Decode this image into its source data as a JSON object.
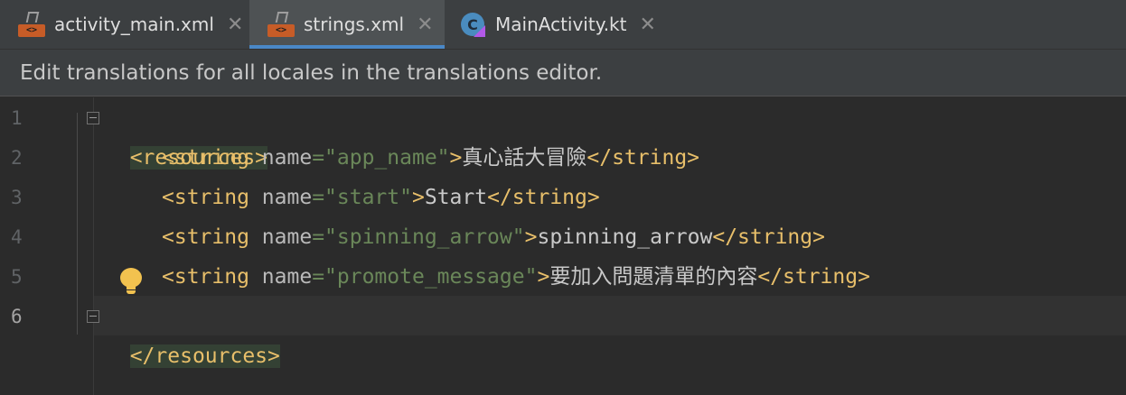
{
  "tabs": [
    {
      "label": "activity_main.xml",
      "icon": "xml-file-icon",
      "active": false
    },
    {
      "label": "strings.xml",
      "icon": "xml-file-icon",
      "active": true
    },
    {
      "label": "MainActivity.kt",
      "icon": "kotlin-file-icon",
      "active": false
    }
  ],
  "tab_close_glyph": "✕",
  "banner": {
    "text": "Edit translations for all locales in the translations editor."
  },
  "line_numbers": [
    "1",
    "2",
    "3",
    "4",
    "5",
    "6"
  ],
  "code": {
    "open_resources": "<resources>",
    "close_resources": "</resources>",
    "string_open": "<string",
    "name_attr": "name",
    "equals": "=",
    "gt": ">",
    "string_close": "</string>",
    "strings": [
      {
        "name": "\"app_name\"",
        "value": "真心話大冒險"
      },
      {
        "name": "\"start\"",
        "value": "Start"
      },
      {
        "name": "\"spinning_arrow\"",
        "value": "spinning_arrow"
      },
      {
        "name": "\"promote_message\"",
        "value": "要加入問題清單的內容"
      }
    ]
  },
  "colors": {
    "tag": "#e8bf6a",
    "attribute": "#bababa",
    "attribute_value": "#6a8759",
    "background": "#2b2b2b",
    "active_tab_indicator": "#4a88c7"
  }
}
